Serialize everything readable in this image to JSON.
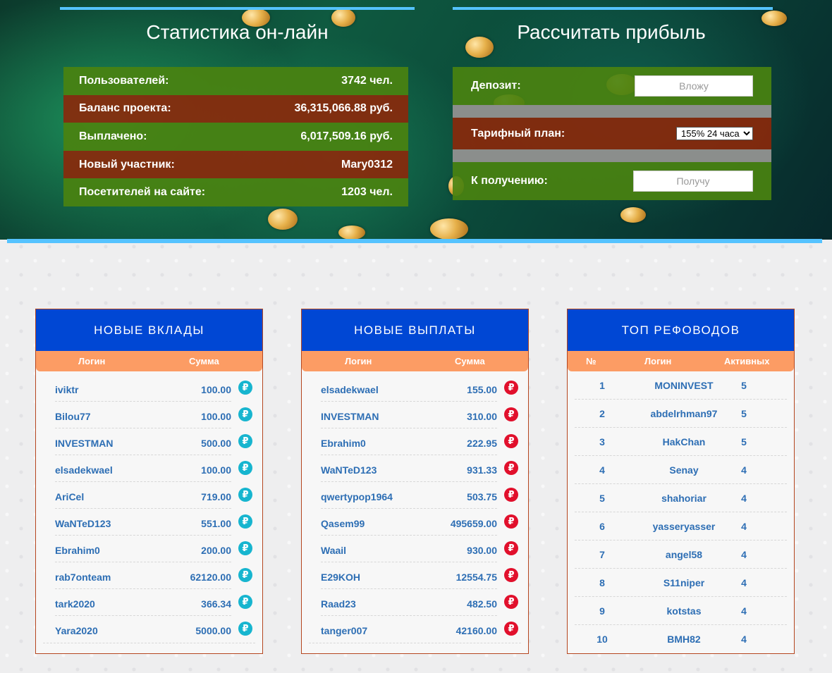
{
  "stats": {
    "title": "Статистика он-лайн",
    "rows": [
      {
        "label": "Пользователей:",
        "value": "3742 чел."
      },
      {
        "label": "Баланс проекта:",
        "value": "36,315,066.88 руб."
      },
      {
        "label": "Выплачено:",
        "value": "6,017,509.16 руб."
      },
      {
        "label": "Новый участник:",
        "value": "Mary0312"
      },
      {
        "label": "Посетителей на сайте:",
        "value": "1203 чел."
      }
    ]
  },
  "calc": {
    "title": "Рассчитать прибыль",
    "deposit_label": "Депозит:",
    "deposit_placeholder": "Вложу",
    "plan_label": "Тарифный план:",
    "plan_selected": "155% 24 часа",
    "receive_label": "К получению:",
    "receive_placeholder": "Получу"
  },
  "deposits": {
    "title": "НОВЫЕ ВКЛАДЫ",
    "col_login": "Логин",
    "col_sum": "Сумма",
    "currency_icon": "ruble-icon",
    "rows": [
      {
        "login": "iviktr",
        "sum": "100.00"
      },
      {
        "login": "Bilou77",
        "sum": "100.00"
      },
      {
        "login": "INVESTMAN",
        "sum": "500.00"
      },
      {
        "login": "elsadekwael",
        "sum": "100.00"
      },
      {
        "login": "AriCel",
        "sum": "719.00"
      },
      {
        "login": "WaNTeD123",
        "sum": "551.00"
      },
      {
        "login": "Ebrahim0",
        "sum": "200.00"
      },
      {
        "login": "rab7onteam",
        "sum": "62120.00"
      },
      {
        "login": "tark2020",
        "sum": "366.34"
      },
      {
        "login": "Yara2020",
        "sum": "5000.00"
      }
    ]
  },
  "payouts": {
    "title": "НОВЫЕ ВЫПЛАТЫ",
    "col_login": "Логин",
    "col_sum": "Сумма",
    "currency_icon": "ruble-icon",
    "rows": [
      {
        "login": "elsadekwael",
        "sum": "155.00"
      },
      {
        "login": "INVESTMAN",
        "sum": "310.00"
      },
      {
        "login": "Ebrahim0",
        "sum": "222.95"
      },
      {
        "login": "WaNTeD123",
        "sum": "931.33"
      },
      {
        "login": "qwertypop1964",
        "sum": "503.75"
      },
      {
        "login": "Qasem99",
        "sum": "495659.00"
      },
      {
        "login": "Waail",
        "sum": "930.00"
      },
      {
        "login": "E29KOH",
        "sum": "12554.75"
      },
      {
        "login": "Raad23",
        "sum": "482.50"
      },
      {
        "login": "tanger007",
        "sum": "42160.00"
      }
    ]
  },
  "referrers": {
    "title": "ТОП РЕФОВОДОВ",
    "col_num": "№",
    "col_login": "Логин",
    "col_active": "Активных",
    "rows": [
      {
        "num": "1",
        "login": "MONINVEST",
        "active": "5"
      },
      {
        "num": "2",
        "login": "abdelrhman97",
        "active": "5"
      },
      {
        "num": "3",
        "login": "HakChan",
        "active": "5"
      },
      {
        "num": "4",
        "login": "Senay",
        "active": "4"
      },
      {
        "num": "5",
        "login": "shahoriar",
        "active": "4"
      },
      {
        "num": "6",
        "login": "yasseryasser",
        "active": "4"
      },
      {
        "num": "7",
        "login": "angel58",
        "active": "4"
      },
      {
        "num": "8",
        "login": "S11niper",
        "active": "4"
      },
      {
        "num": "9",
        "login": "kotstas",
        "active": "4"
      },
      {
        "num": "10",
        "login": "BMH82",
        "active": "4"
      }
    ]
  },
  "colors": {
    "accent_blue": "#0047d4",
    "header_orange": "#fc9c64",
    "line_cyan": "#55c3ff",
    "row_green": "#4a8210",
    "row_red": "#8c280a",
    "text_blue": "#2d6eb4",
    "ruble_teal": "#17b5cf",
    "ruble_red": "#e1102c"
  }
}
